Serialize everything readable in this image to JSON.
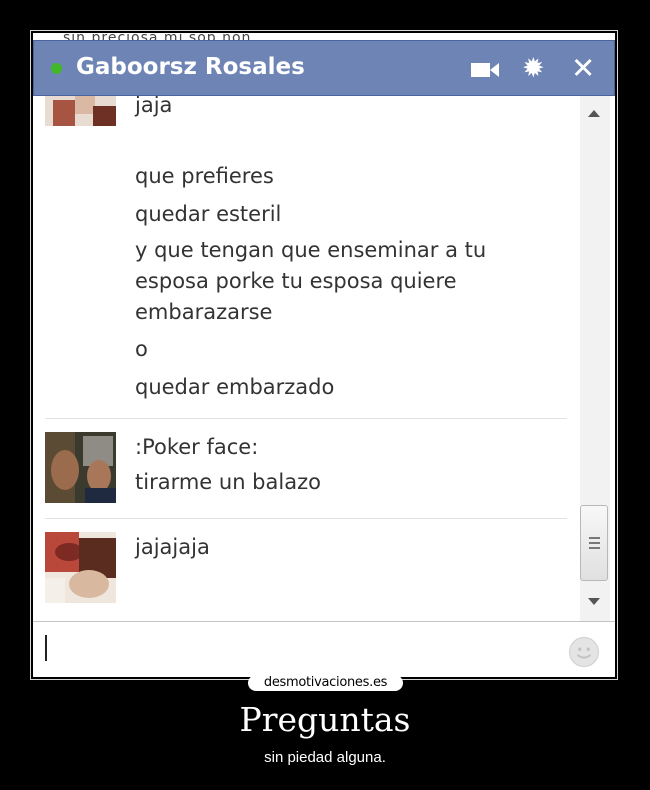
{
  "chat": {
    "top_strip_text": "sin preciosa mi sop non",
    "contact_name": "Gaboorsz Rosales",
    "status_color": "#42b72a",
    "header_color": "#6d84b4",
    "icons": [
      "video-call-icon",
      "gear-icon",
      "close-icon"
    ],
    "messages": {
      "group1_lines": [
        "jaja",
        "que prefieres",
        "quedar esteril",
        "y que tengan que enseminar a tu",
        "esposa porke tu esposa quiere",
        "embarazarse",
        "o",
        "quedar embarzado"
      ],
      "group2_lines": [
        ":Poker face:",
        "tirarme un balazo"
      ],
      "group3_lines": [
        "jajajaja"
      ]
    },
    "input": {
      "value": "",
      "placeholder": ""
    }
  },
  "poster": {
    "site": "desmotivaciones.es",
    "title": "Preguntas",
    "subtitle": "sin piedad alguna."
  }
}
